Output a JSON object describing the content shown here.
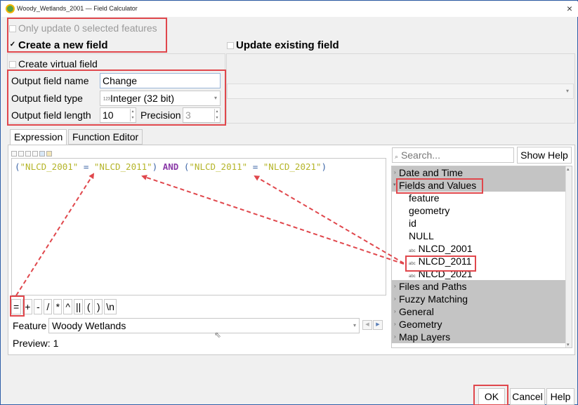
{
  "window": {
    "title": "Woody_Wetlands_2001 — Field Calculator",
    "close_glyph": "×"
  },
  "options": {
    "only_update_label": "Only update 0 selected features",
    "create_new_label": "Create a new field",
    "update_existing_label": "Update existing field",
    "create_virtual_label": "Create virtual field"
  },
  "fields": {
    "name_label": "Output field name",
    "name_value": "Change",
    "type_label": "Output field type",
    "type_icon": "123",
    "type_value": "Integer (32 bit)",
    "length_label": "Output field length",
    "length_value": "10",
    "precision_label": "Precision",
    "precision_value": "3"
  },
  "tabs": {
    "expression": "Expression",
    "function_editor": "Function Editor"
  },
  "expression": {
    "p1": "(",
    "s1": "\"NLCD_2001\"",
    "op1": " = ",
    "s2": "\"NLCD_2011\"",
    "p2": ")",
    "and": " AND ",
    "p3": "(",
    "s3": "\"NLCD_2011\"",
    "op2": " = ",
    "s4": "\"NLCD_2021\"",
    "p4": ")"
  },
  "operators": [
    "=",
    "+",
    "-",
    "/",
    "*",
    "^",
    "||",
    "(",
    ")",
    "\\n"
  ],
  "feature": {
    "label": "Feature",
    "value": "Woody Wetlands"
  },
  "preview": "Preview: 1",
  "search": {
    "placeholder": "Search...",
    "show_help": "Show Help"
  },
  "tree": {
    "date_time": "Date and Time",
    "fields_values": "Fields and Values",
    "feature": "feature",
    "geometry": "geometry",
    "id": "id",
    "null": "NULL",
    "field_icon": "abc",
    "nlcd2001": "NLCD_2001",
    "nlcd2011": "NLCD_2011",
    "nlcd2021": "NLCD_2021",
    "files_paths": "Files and Paths",
    "fuzzy": "Fuzzy Matching",
    "general": "General",
    "geometry_grp": "Geometry",
    "map_layers": "Map Layers"
  },
  "buttons": {
    "ok": "OK",
    "cancel": "Cancel",
    "help": "Help"
  },
  "colors": {
    "highlight_red": "#e0474c",
    "arrow_red": "#e0474c",
    "group_row": "#c4c4c4"
  }
}
